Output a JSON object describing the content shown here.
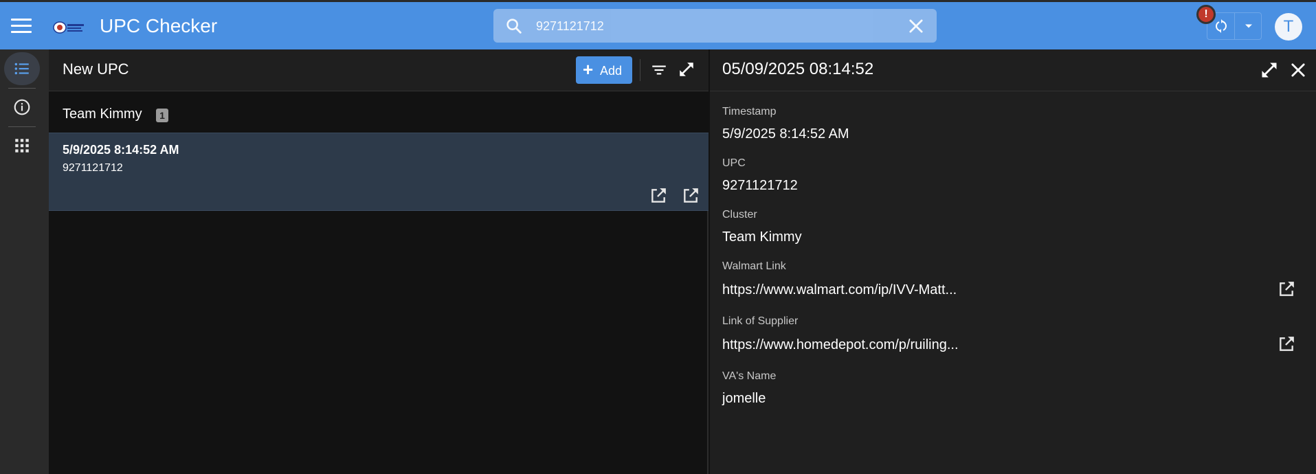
{
  "app": {
    "title": "UPC Checker",
    "accent_color": "#4a90e2",
    "avatar_initial": "T",
    "alert_symbol": "!"
  },
  "search": {
    "value": "9271121712",
    "icon": "search-icon",
    "clear_icon": "close-icon"
  },
  "rail": {
    "items": [
      {
        "icon": "list-icon",
        "active": true
      },
      {
        "icon": "info-icon",
        "active": false
      },
      {
        "icon": "apps-grid-icon",
        "active": false
      }
    ]
  },
  "list": {
    "title": "New UPC",
    "add_label": "Add",
    "group": {
      "name": "Team Kimmy",
      "count": "1"
    },
    "rows": [
      {
        "timestamp": "5/9/2025 8:14:52 AM",
        "upc": "9271121712"
      }
    ]
  },
  "detail": {
    "title": "05/09/2025 08:14:52",
    "fields": [
      {
        "label": "Timestamp",
        "value": "5/9/2025 8:14:52 AM"
      },
      {
        "label": "UPC",
        "value": "9271121712"
      },
      {
        "label": "Cluster",
        "value": "Team Kimmy"
      },
      {
        "label": "Walmart Link",
        "value": "https://www.walmart.com/ip/IVV-Matt..."
      },
      {
        "label": "Link of Supplier",
        "value": "https://www.homedepot.com/p/ruiling..."
      },
      {
        "label": "VA's Name",
        "value": "jomelle"
      }
    ]
  }
}
